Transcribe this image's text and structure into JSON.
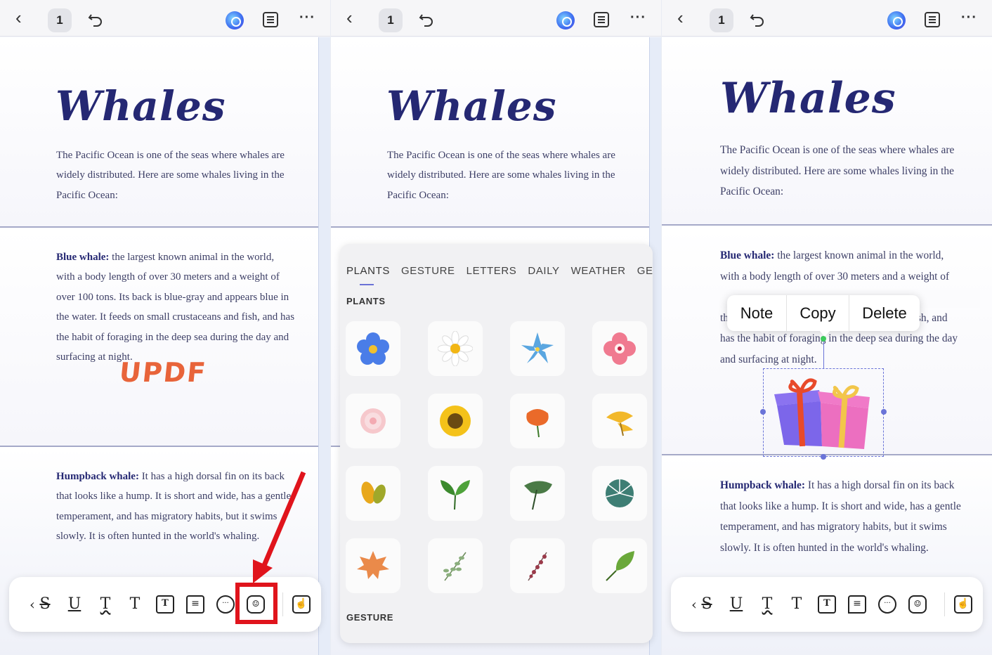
{
  "topbar": {
    "back_icon": "chevron-left-icon",
    "page_number": "1",
    "undo_icon": "undo-icon",
    "ai_icon": "ai-assistant-icon",
    "outline_icon": "outline-list-icon",
    "more_icon": "more-horizontal-icon",
    "back_glyph": "‹",
    "more_glyph": "···"
  },
  "document": {
    "title": "Whales",
    "intro": "The Pacific Ocean is one of the seas where whales are widely distributed. Here are some whales living in the Pacific Ocean:",
    "blue_whale_label": "Blue whale:",
    "blue_whale_text": " the largest known animal in the world, with a body length of over 30 meters and a weight of over 100 tons. Its back is blue-gray and appears blue in the water. It feeds on small crustaceans and fish, and has the habit of foraging in the deep sea during the day and surfacing at night.",
    "humpback_label": "Humpback whale:",
    "humpback_text": " It has a high dorsal fin on its back that looks like a hump. It is short and wide, has a gentle temperament, and has migratory habits, but it swims slowly. It is often hunted in the world's whaling.",
    "stamp_text": "UPDF"
  },
  "toolbar": {
    "tools": [
      {
        "name": "strikethrough-icon",
        "glyph": "S"
      },
      {
        "name": "underline-icon",
        "glyph": "U"
      },
      {
        "name": "squiggly-underline-icon",
        "glyph": "T"
      },
      {
        "name": "text-icon",
        "glyph": "T"
      },
      {
        "name": "text-box-icon",
        "glyph": "T"
      },
      {
        "name": "text-callout-icon",
        "glyph": "≡"
      },
      {
        "name": "comment-icon",
        "glyph": "···"
      },
      {
        "name": "sticker-icon",
        "glyph": "☺"
      },
      {
        "name": "hand-tool-icon",
        "glyph": "☝"
      }
    ],
    "collapse_glyph": "‹"
  },
  "sticker_picker": {
    "tabs": [
      "PLANTS",
      "GESTURE",
      "LETTERS",
      "DAILY",
      "WEATHER",
      "GEOM"
    ],
    "active_tab": "PLANTS",
    "section_plants": "PLANTS",
    "section_gesture": "GESTURE",
    "stickers": [
      "blue-flower-icon",
      "daisy-icon",
      "blue-lily-icon",
      "pink-hibiscus-icon",
      "pink-chrysanthemum-icon",
      "sunflower-icon",
      "orange-poppy-icon",
      "ginkgo-leaf-icon",
      "yellow-leaves-icon",
      "green-sprout-icon",
      "monstera-branch-icon",
      "palm-leaf-icon",
      "maple-leaf-icon",
      "eucalyptus-sprig-icon",
      "lavender-sprig-icon",
      "green-leaf-icon"
    ]
  },
  "context_menu": {
    "note": "Note",
    "copy": "Copy",
    "delete": "Delete"
  },
  "selected_sticker": "gift-box-icon",
  "colors": {
    "title": "#252873",
    "highlight": "#e0141c",
    "accent": "#6b72d6",
    "stamp": "#e8643a"
  }
}
